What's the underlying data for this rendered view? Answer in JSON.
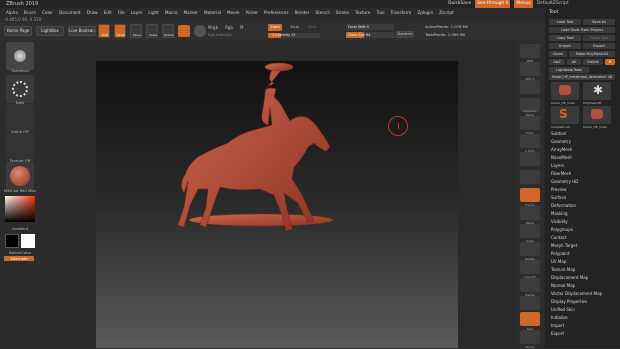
{
  "title": "ZBrush 2019",
  "menu": [
    "Alpha",
    "Brush",
    "Color",
    "Document",
    "Draw",
    "Edit",
    "File",
    "Layer",
    "Light",
    "Macro",
    "Marker",
    "Material",
    "Movie",
    "Picker",
    "Preferences",
    "Render",
    "Stencil",
    "Stroke",
    "Texture",
    "Tool",
    "Transform",
    "Zplugin",
    "Zscript"
  ],
  "top_right": {
    "quicksave": "QuickSave",
    "seethrough": "See-through 0",
    "menus": "Menus",
    "default_zscript": "DefaultZScript"
  },
  "coords": "-0.465,0.99,-0.510",
  "toolbar": {
    "home": "Home Page",
    "lightbox": "LightBox",
    "live_boolean": "Live Boolean",
    "edit": "Edit",
    "draw": "Draw",
    "move": "Move",
    "scale": "Scale",
    "rotate": "Rotate",
    "mrgb": "Mrgb",
    "rgb": "Rgb",
    "m": "M",
    "zadd": "Zadd",
    "zsub": "Zsub",
    "zcut": "Zcut",
    "rgb_intensity": "Rgb Intensity",
    "z_intensity": "Z Intensity 25",
    "focal_shift": "Focal Shift 0",
    "draw_size": "Draw Size 64",
    "dynamic": "Dynamic",
    "active_points": "ActivePoints: 1.078 Mil",
    "total_points": "TotalPoints: 1.099 Mil"
  },
  "left": {
    "standard": "Standard",
    "dots": "Dots",
    "alpha": "Alpha Off",
    "texture": "Texture Off",
    "matcap": "MatCap Red Wax",
    "gradient": "Gradient",
    "switch_color": "SwitchColor",
    "alternate": "Alternate"
  },
  "right_shelf": [
    "BPR",
    "SPix 3",
    "",
    "Dynamic Persp",
    "Floor",
    "L.Sym",
    "",
    "",
    "Frame",
    "Move",
    "Scale",
    "Rotate",
    "Line Fill",
    "Transp",
    "Ghost",
    "Solo",
    "Xpose"
  ],
  "tray": {
    "tool_header": "Tool",
    "load_tool": "Load Tool",
    "save_as": "Save As",
    "load_project": "Load Tools From Project",
    "copy_tool": "Copy Tool",
    "paste_tool": "Paste Tool",
    "import": "Import",
    "export": "Export",
    "clone": "Clone",
    "make_polymesh": "Make PolyMesh3D",
    "goz": "GoZ",
    "all": "All",
    "visible": "Visible",
    "r": "R",
    "lightbox_tools": "Lightbox▸Tools",
    "model_name": "Model_HP_metalmaps_decimated: 48",
    "thumbs": [
      "Model_HP_meta",
      "PolyMesh3D",
      "SimpleBrush",
      "Model_HP_meta"
    ],
    "subtools": [
      "Subtool",
      "Geometry",
      "ArrayMesh",
      "NanoMesh",
      "Layers",
      "FiberMesh",
      "Geometry HD",
      "Preview",
      "Surface",
      "Deformation",
      "Masking",
      "Visibility",
      "Polygroups",
      "Contact",
      "Morph Target",
      "Polypaint",
      "UV Map",
      "Texture Map",
      "Displacement Map",
      "Normal Map",
      "Vector Displacement Map",
      "Display Properties",
      "Unified Skin",
      "Initialize",
      "Import",
      "Export"
    ]
  },
  "colors": {
    "accent": "#d0682a",
    "model": "#b4503a"
  }
}
